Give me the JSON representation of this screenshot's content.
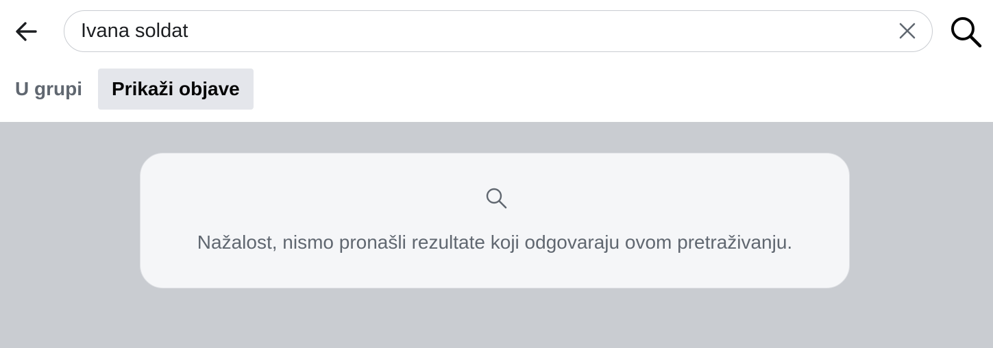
{
  "search": {
    "value": "Ivana soldat"
  },
  "filters": [
    {
      "label": "U grupi",
      "active": false
    },
    {
      "label": "Prikaži objave",
      "active": true
    }
  ],
  "empty_state": {
    "message": "Nažalost, nismo pronašli rezultate koji odgovaraju ovom pretraživanju."
  },
  "icons": {
    "back": "arrow-left-icon",
    "clear": "close-icon",
    "search": "search-icon",
    "empty": "search-icon"
  },
  "colors": {
    "background": "#c9ccd1",
    "card": "#f5f6f8",
    "chip_active": "#e4e6eb",
    "text_primary": "#050505",
    "text_secondary": "#606770"
  }
}
